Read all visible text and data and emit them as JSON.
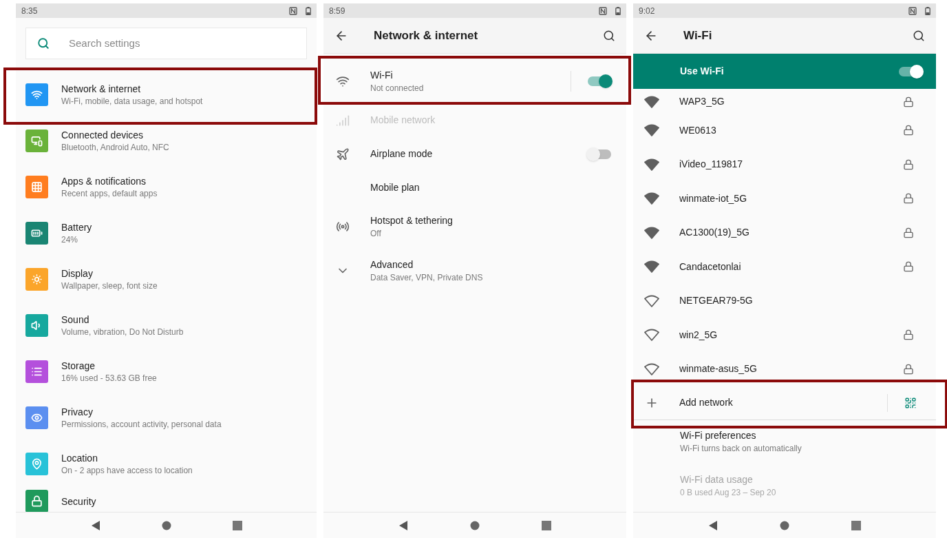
{
  "settings_screen": {
    "status_bar": {
      "time": "8:35"
    },
    "search": {
      "placeholder": "Search settings"
    },
    "items": [
      {
        "title": "Network & internet",
        "subtitle": "Wi-Fi, mobile, data usage, and hotspot",
        "color": "#2196f3",
        "highlighted": true
      },
      {
        "title": "Connected devices",
        "subtitle": "Bluetooth, Android Auto, NFC",
        "color": "#6ab23a",
        "highlighted": false
      },
      {
        "title": "Apps & notifications",
        "subtitle": "Recent apps, default apps",
        "color": "#ff7d1f",
        "highlighted": false
      },
      {
        "title": "Battery",
        "subtitle": "24%",
        "color": "#1a8573",
        "highlighted": false
      },
      {
        "title": "Display",
        "subtitle": "Wallpaper, sleep, font size",
        "color": "#fba52a",
        "highlighted": false
      },
      {
        "title": "Sound",
        "subtitle": "Volume, vibration, Do Not Disturb",
        "color": "#16a89e",
        "highlighted": false
      },
      {
        "title": "Storage",
        "subtitle": "16% used - 53.63 GB free",
        "color": "#b450dc",
        "highlighted": false
      },
      {
        "title": "Privacy",
        "subtitle": "Permissions, account activity, personal data",
        "color": "#5b8ff0",
        "highlighted": false
      },
      {
        "title": "Location",
        "subtitle": "On - 2 apps have access to location",
        "color": "#28c2d8",
        "highlighted": false
      },
      {
        "title": "Security",
        "color": "#1f9a5c",
        "highlighted": false
      }
    ]
  },
  "network_screen": {
    "status_bar": {
      "time": "8:59"
    },
    "title": "Network & internet",
    "items": [
      {
        "kind": "switch",
        "title": "Wi-Fi",
        "subtitle": "Not connected",
        "on": true,
        "disabled": false,
        "highlighted": true
      },
      {
        "kind": "plain",
        "title": "Mobile network",
        "disabled": true,
        "highlighted": false
      },
      {
        "kind": "switch",
        "title": "Airplane mode",
        "on": false,
        "disabled": false,
        "highlighted": false
      },
      {
        "kind": "plain",
        "title": "Mobile plan",
        "disabled": false,
        "highlighted": false
      },
      {
        "kind": "plain",
        "title": "Hotspot & tethering",
        "subtitle": "Off",
        "disabled": false,
        "highlighted": false
      },
      {
        "kind": "plain",
        "title": "Advanced",
        "subtitle": "Data Saver, VPN, Private DNS",
        "disabled": false,
        "highlighted": false
      }
    ]
  },
  "wifi_screen": {
    "status_bar": {
      "time": "9:02"
    },
    "title": "Wi-Fi",
    "use_wifi": {
      "label": "Use Wi-Fi",
      "on": true
    },
    "networks": [
      {
        "name": "WAP3_5G",
        "kind": "strong",
        "secured": true
      },
      {
        "name": "WE0613",
        "kind": "strong",
        "secured": true
      },
      {
        "name": "iVideo_119817",
        "kind": "strong",
        "secured": true
      },
      {
        "name": "winmate-iot_5G",
        "kind": "strong",
        "secured": true
      },
      {
        "name": "AC1300(19)_5G",
        "kind": "strong",
        "secured": true
      },
      {
        "name": "Candacetonlai",
        "kind": "strong",
        "secured": true
      },
      {
        "name": "NETGEAR79-5G",
        "kind": "weak",
        "secured": false
      },
      {
        "name": "win2_5G",
        "kind": "weak",
        "secured": true
      },
      {
        "name": "winmate-asus_5G",
        "kind": "weak",
        "secured": true
      }
    ],
    "add_network": {
      "label": "Add network",
      "highlighted": true
    },
    "preferences": {
      "title": "Wi-Fi preferences",
      "subtitle": "Wi-Fi turns back on automatically",
      "disabled": false
    },
    "data_usage": {
      "title": "Wi-Fi data usage",
      "subtitle": "0 B used Aug 23 – Sep 20",
      "disabled": true
    }
  }
}
